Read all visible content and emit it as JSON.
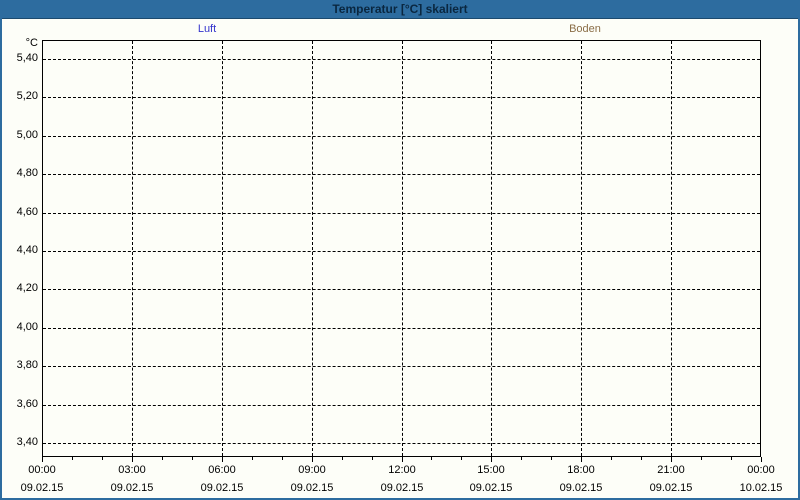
{
  "title": "Temperatur [°C] skaliert",
  "colors": {
    "titlebar_bg": "#2d6c9f",
    "titlebar_text": "#0a2740",
    "window_border": "#2d6c9f",
    "background": "#fdfef8",
    "grid": "#000000",
    "luft": "#3333cc",
    "boden": "#8a6d46"
  },
  "chart_data": {
    "type": "line",
    "title": "Temperatur [°C] skaliert",
    "xlabel": "",
    "ylabel": "°C",
    "ylim": [
      3.33,
      5.5
    ],
    "grid": true,
    "legend_position": "top",
    "y_ticks": [
      "5,40",
      "5,20",
      "5,00",
      "4,80",
      "4,60",
      "4,40",
      "4,20",
      "4,00",
      "3,80",
      "3,60",
      "3,40"
    ],
    "x_ticks": [
      {
        "time": "00:00",
        "date": "09.02.15"
      },
      {
        "time": "03:00",
        "date": "09.02.15"
      },
      {
        "time": "06:00",
        "date": "09.02.15"
      },
      {
        "time": "09:00",
        "date": "09.02.15"
      },
      {
        "time": "12:00",
        "date": "09.02.15"
      },
      {
        "time": "15:00",
        "date": "09.02.15"
      },
      {
        "time": "18:00",
        "date": "09.02.15"
      },
      {
        "time": "21:00",
        "date": "09.02.15"
      },
      {
        "time": "00:00",
        "date": "10.02.15"
      }
    ],
    "minor_ticks_per_hour": true,
    "series": [
      {
        "name": "Luft",
        "color": "#3333cc",
        "x": [],
        "values": []
      },
      {
        "name": "Boden",
        "color": "#8a6d46",
        "x": [],
        "values": []
      }
    ]
  }
}
